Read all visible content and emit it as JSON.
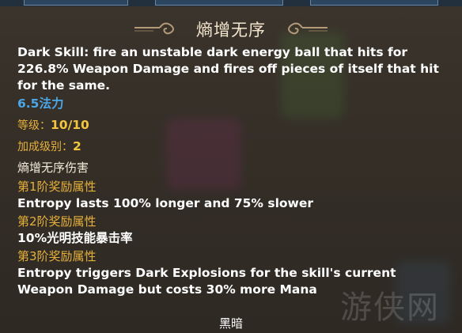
{
  "skill": {
    "name": "熵增无序",
    "description": "Dark Skill: fire an unstable dark energy ball that hits for 226.8% Weapon Damage and fires off pieces of itself that hit for the same.",
    "mana_cost": "6.5法力",
    "level_label": "等级：",
    "level_value": "10/10",
    "bonus_label": "加成级别：",
    "bonus_value": "2",
    "damage_label": "熵增无序伤害"
  },
  "tiers": [
    {
      "title": "第1阶奖励属性",
      "text": "Entropy lasts 100% longer and 75% slower"
    },
    {
      "title": "第2阶奖励属性",
      "text": "10%光明技能暴击率"
    },
    {
      "title": "第3阶奖励属性",
      "text": "Entropy triggers Dark Explosions for the skill's current Weapon Damage but costs 30% more Mana"
    }
  ],
  "footer": {
    "element": "黑暗"
  },
  "colors": {
    "accent_blue": "#4aa7e8",
    "gold": "#e6b13a",
    "panel": "#342e27"
  }
}
